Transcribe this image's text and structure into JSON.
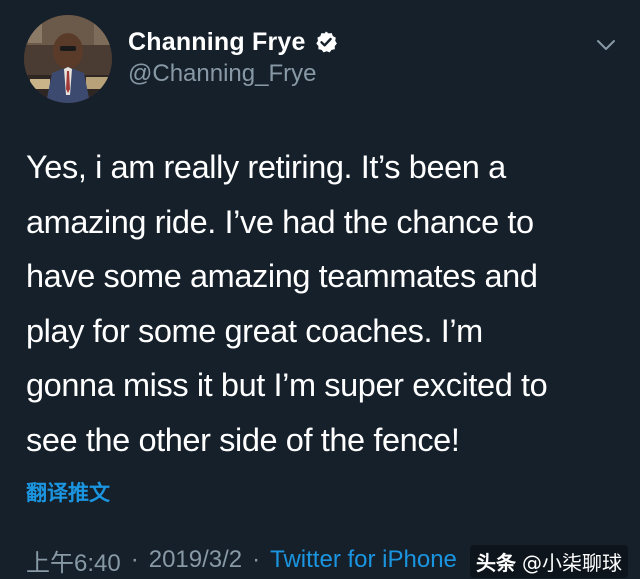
{
  "user": {
    "display_name": "Channing Frye",
    "handle": "@Channing_Frye",
    "verified": true,
    "avatar_icon": "avatar-photo"
  },
  "tweet": {
    "text": "Yes, i am really retiring. It’s been a\namazing ride. I’ve had the chance to\nhave some amazing teammates and\nplay for some great coaches. I’m\ngonna miss it but I’m super excited to\nsee the other side of the fence!",
    "translate_label": "翻译推文"
  },
  "meta": {
    "time": "上午6:40",
    "separator": "·",
    "date": "2019/3/2",
    "client": "Twitter for iPhone"
  },
  "watermark": {
    "logo": "头条",
    "account": "@小柒聊球"
  },
  "colors": {
    "background": "#15202b",
    "accent": "#1b95e0",
    "secondary_text": "#8899a6"
  }
}
